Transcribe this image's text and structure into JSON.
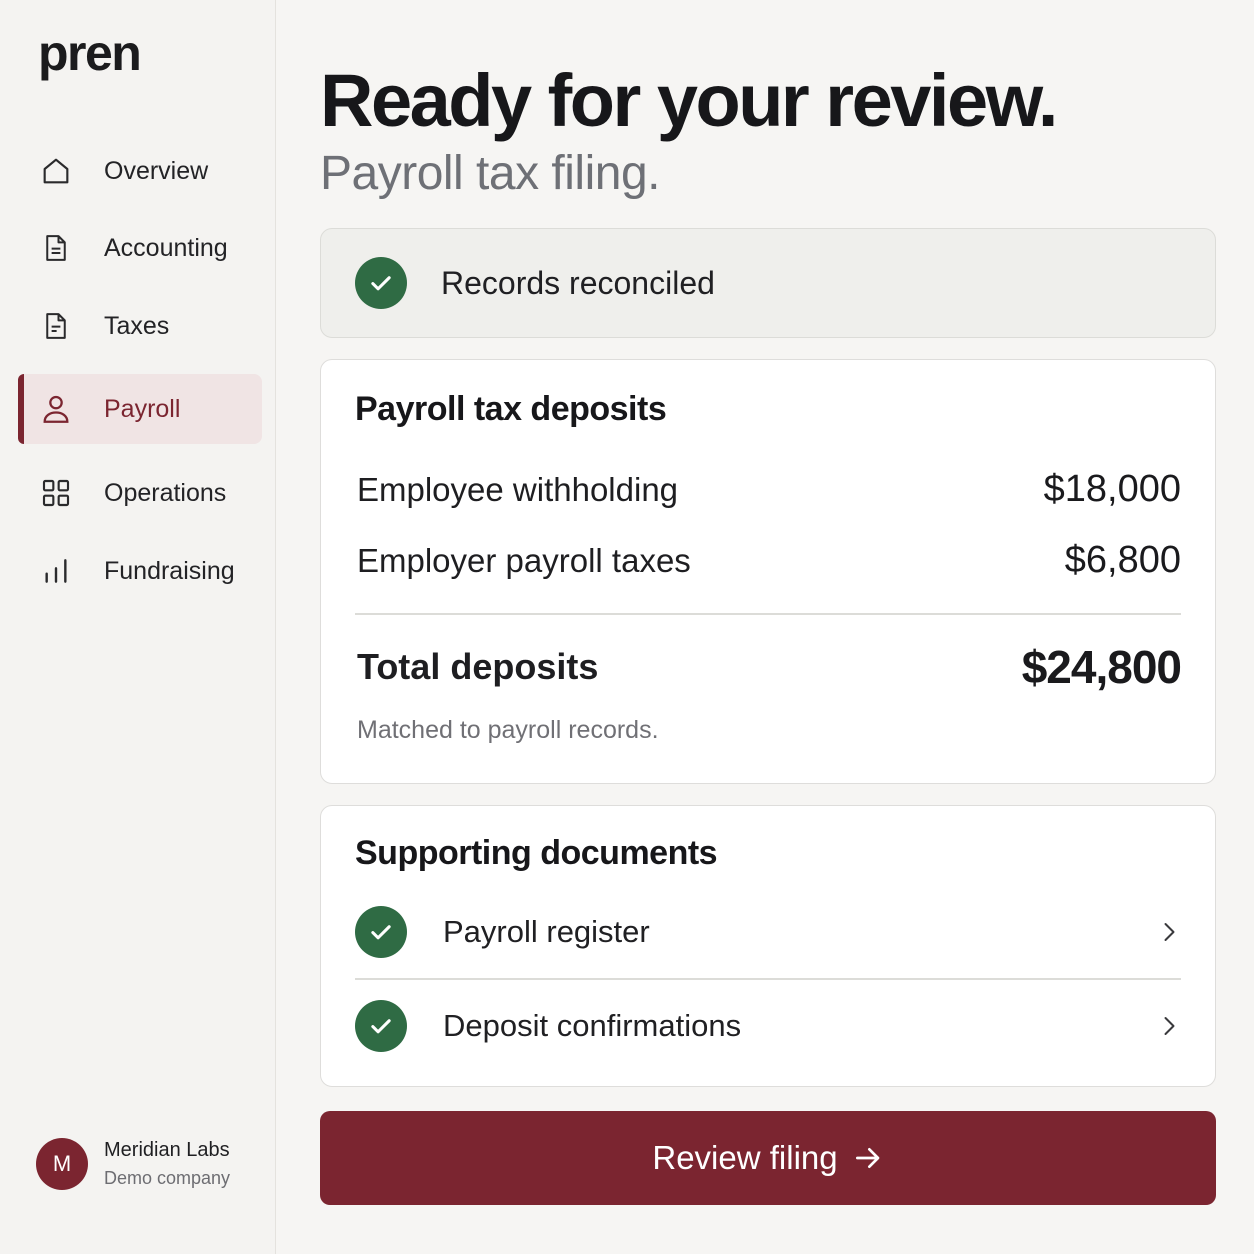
{
  "brand": {
    "logo": "pren",
    "accent": "#7b2530",
    "success": "#2f6b44"
  },
  "sidebar": {
    "items": [
      {
        "label": "Overview",
        "icon": "home-icon",
        "active": false
      },
      {
        "label": "Accounting",
        "icon": "document-icon",
        "active": false
      },
      {
        "label": "Taxes",
        "icon": "document-icon",
        "active": false
      },
      {
        "label": "Payroll",
        "icon": "user-icon",
        "active": true
      },
      {
        "label": "Operations",
        "icon": "grid-icon",
        "active": false
      },
      {
        "label": "Fundraising",
        "icon": "bar-chart-icon",
        "active": false
      }
    ],
    "account": {
      "initial": "M",
      "name": "Meridian Labs",
      "subtitle": "Demo company"
    }
  },
  "main": {
    "title": "Ready for your review.",
    "subtitle": "Payroll tax filing.",
    "status": {
      "label": "Records reconciled",
      "icon": "check-circle-icon"
    },
    "deposits": {
      "title": "Payroll tax deposits",
      "rows": [
        {
          "label": "Employee withholding",
          "value": "$18,000"
        },
        {
          "label": "Employer payroll taxes",
          "value": "$6,800"
        }
      ],
      "total": {
        "label": "Total deposits",
        "value": "$24,800"
      },
      "note": "Matched to payroll records."
    },
    "documents": {
      "title": "Supporting documents",
      "items": [
        {
          "label": "Payroll register",
          "icon": "check-circle-icon"
        },
        {
          "label": "Deposit confirmations",
          "icon": "check-circle-icon"
        }
      ]
    },
    "cta": {
      "label": "Review filing",
      "icon": "arrow-right-icon"
    }
  }
}
